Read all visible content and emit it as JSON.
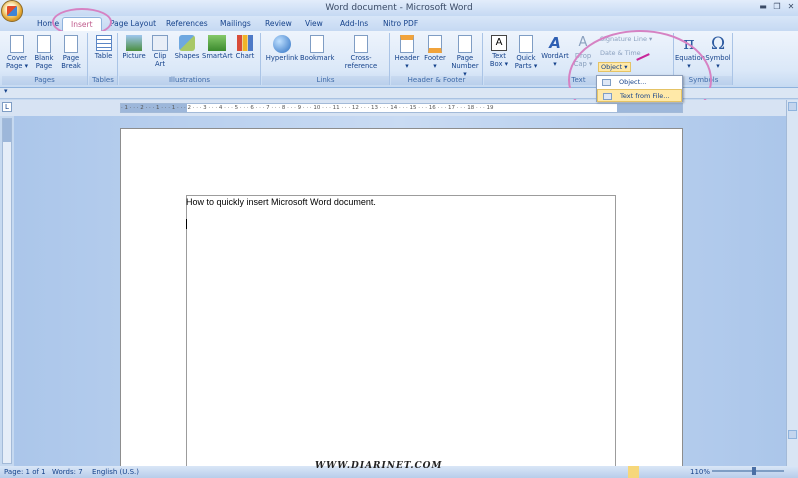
{
  "window": {
    "title": "Word document - Microsoft Word",
    "min": "▬",
    "max": "❐",
    "close": "✕"
  },
  "tabs": [
    "Home",
    "Insert",
    "Page Layout",
    "References",
    "Mailings",
    "Review",
    "View",
    "Add-Ins",
    "Nitro PDF"
  ],
  "groups": {
    "pages": {
      "label": "Pages",
      "buttons": [
        [
          "Cover",
          "Page ▾"
        ],
        [
          "Blank",
          "Page"
        ],
        [
          "Page",
          "Break"
        ]
      ]
    },
    "tables": {
      "label": "Tables",
      "buttons": [
        [
          "Table",
          ""
        ]
      ]
    },
    "illustrations": {
      "label": "Illustrations",
      "buttons": [
        [
          "Picture",
          ""
        ],
        [
          "Clip",
          "Art"
        ],
        [
          "Shapes",
          ""
        ],
        [
          "SmartArt",
          ""
        ],
        [
          "Chart",
          ""
        ]
      ]
    },
    "links": {
      "label": "Links",
      "buttons": [
        [
          "Hyperlink",
          ""
        ],
        [
          "Bookmark",
          ""
        ],
        [
          "Cross-reference",
          ""
        ]
      ]
    },
    "header_footer": {
      "label": "Header & Footer",
      "buttons": [
        [
          "Header",
          "▾"
        ],
        [
          "Footer",
          "▾"
        ],
        [
          "Page",
          "Number ▾"
        ]
      ]
    },
    "text": {
      "label": "Text",
      "buttons": [
        [
          "Text",
          "Box ▾"
        ],
        [
          "Quick",
          "Parts ▾"
        ],
        [
          "WordArt",
          "▾"
        ],
        [
          "Drop",
          "Cap ▾"
        ]
      ],
      "small": [
        "Signature Line ▾",
        "Date & Time",
        "Object ▾"
      ]
    },
    "symbols": {
      "label": "Symbols",
      "buttons": [
        [
          "Equation",
          "▾"
        ],
        [
          "Symbol",
          "▾"
        ]
      ]
    }
  },
  "dropdown": {
    "items": [
      "Object...",
      "Text from File..."
    ]
  },
  "ruler": {
    "h": "· 1 · · · 2 · · · 1 · · · 1 · · · 2 · · · 3 · · · 4 · · · 5 · · · 6 · · · 7 · · · 8 · · · 9 · · · 10 · · · 11 · · · 12 · · · 13 · · · 14 · · · 15 · · · 16 · · · 17 · · · 18 · · · 19"
  },
  "document": {
    "text": "How to quickly insert Microsoft Word document."
  },
  "status": {
    "page": "Page: 1 of 1",
    "words": "Words: 7",
    "lang": "English (U.S.)",
    "zoom": "110%"
  },
  "watermark": "WWW.DIARINET.COM"
}
